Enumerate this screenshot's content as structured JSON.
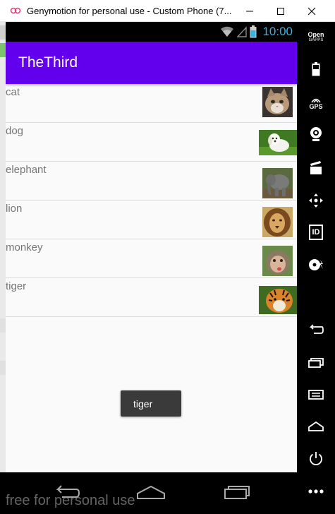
{
  "window": {
    "title": "Genymotion for personal use - Custom Phone (7..."
  },
  "status_bar": {
    "time": "10:00"
  },
  "app_bar": {
    "title": "TheThird"
  },
  "animals": [
    {
      "label": "cat",
      "image": "cat-photo"
    },
    {
      "label": "dog",
      "image": "dog-photo"
    },
    {
      "label": "elephant",
      "image": "elephant-photo"
    },
    {
      "label": "lion",
      "image": "lion-photo"
    },
    {
      "label": "monkey",
      "image": "monkey-photo"
    },
    {
      "label": "tiger",
      "image": "tiger-photo"
    }
  ],
  "toast": {
    "text": "tiger"
  },
  "watermark": "free for personal use",
  "toolbar": {
    "gapps_line1": "Open",
    "gapps_line2": "GAPPS",
    "gps_label": "GPS",
    "id_label": "ID",
    "items": [
      "open-gapps-icon",
      "battery-icon",
      "gps-icon",
      "webcam-icon",
      "media-clapper-icon",
      "dpad-move-icon",
      "device-id-icon",
      "disk-io-icon",
      "back-icon",
      "recent-apps-icon",
      "menu-icon",
      "home-icon",
      "power-icon",
      "more-icon"
    ]
  },
  "colors": {
    "app_bar": "#6200ee",
    "status_clock": "#33b5e5",
    "toast_bg": "#3a3a3a"
  }
}
